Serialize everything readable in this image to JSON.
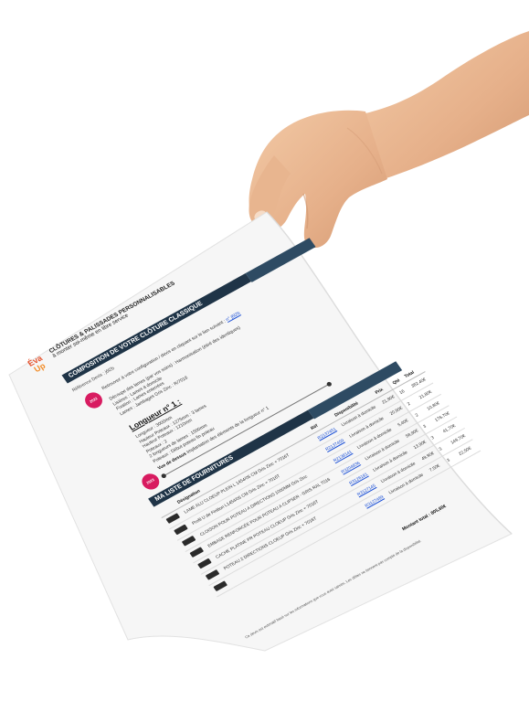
{
  "brand": {
    "logo_line1": "Éva",
    "logo_line2": "Up"
  },
  "header": {
    "title": "CLÔTURES & PALISSADES PERSONNALISABLES",
    "subtitle": "à monter soi-même en libre service"
  },
  "composition": {
    "band_title": "COMPOSITION DE VOTRE CLÔTURE CLASSIQUE",
    "reference_label": "Référence Devis : j6l2b",
    "badge_text": "2023",
    "intro_text": "Retrouvez à votre configuration / devis en cliquant sur le lien suivant :",
    "intro_link": "n° j6l2b",
    "bullets": [
      "Découpe des lames (par vos soins) : Harmonisation (étiré des identiques)",
      "Lisières : Lames à domicile",
      "Fixation : Lames enterrées",
      "Lames : Jambages Gris Zinc : R/7016"
    ],
    "length_title": "Longueur n° 1 :",
    "length_bullets": [
      "Longueur : 3000mm",
      "Hauteur Poteaux : 1275mm : 3 lames",
      "Hauteur Poteaux : 1210mm",
      "Poteaux : 2",
      "2 longueurs de lames : 1500mm",
      "Poteaux : Début poteau fin poteau"
    ],
    "view_label": "Vue de dessus",
    "view_text": "Implantation des éléments de la longueur n° 1"
  },
  "supplies": {
    "band_title": "MA LISTE DE FOURNITURES",
    "columns": [
      "Désignation",
      "Réf",
      "Disponibilité",
      "Prix",
      "Qté",
      "Total"
    ],
    "rows": [
      {
        "designation": "LAME ALU CLOEUP PLEIN L 1454/05 CM Gris Zinc + 7016T",
        "ref": "R2137451",
        "availability": "Livraison à domicile",
        "price": "21,90€",
        "qty": "16",
        "total": "382,40€"
      },
      {
        "designation": "Profil U de Finition L1454/05 CM Gris Zinc + 7016T",
        "ref": "R2137459",
        "availability": "Livraison à domicile",
        "price": "20,90€",
        "qty": "2",
        "total": "21,80€"
      },
      {
        "designation": "CLOISON POUR POTEAU A DIRECTIONS 1000MM Gris Zinc",
        "ref": "R2138141",
        "availability": "Livraison à domicile",
        "price": "5,40€",
        "qty": "2",
        "total": "10,80€"
      },
      {
        "designation": "EMBASE RENFORCÉE POUR POTEAU A CLIPSER - GRIS RAL 7016",
        "ref": "R3204836",
        "availability": "Livraison à domicile",
        "price": "58,90€",
        "qty": "3",
        "total": "176,70€"
      },
      {
        "designation": "CACHE PLATINE PR POTEAU CLOEUP Gris Zinc + 7016T",
        "ref": "R3126181",
        "availability": "Livraison à domicile",
        "price": "13,90€",
        "qty": "3",
        "total": "41,70€"
      },
      {
        "designation": "POTEAU 2 DIRECTIONS CLOEUP Gris Zinc + 7016T",
        "ref": "R3127145",
        "availability": "Livraison à domicile",
        "price": "49,90€",
        "qty": "3",
        "total": "149,70€"
      },
      {
        "designation": "",
        "ref": "R3127469",
        "availability": "Livraison à domicile",
        "price": "7,50€",
        "qty": "3",
        "total": "22,50€"
      }
    ],
    "total_label": "Montant total : 805,60€",
    "footnote": "Ce devis est estimatif basé sur les informations que vous avez saisies. Les délais ne tiennent pas compte de la disponibilité."
  },
  "colors": {
    "band": "#1f3447",
    "brand_orange": "#e6522c",
    "badge_pink": "#d81b60",
    "link_blue": "#1a4fd6"
  }
}
